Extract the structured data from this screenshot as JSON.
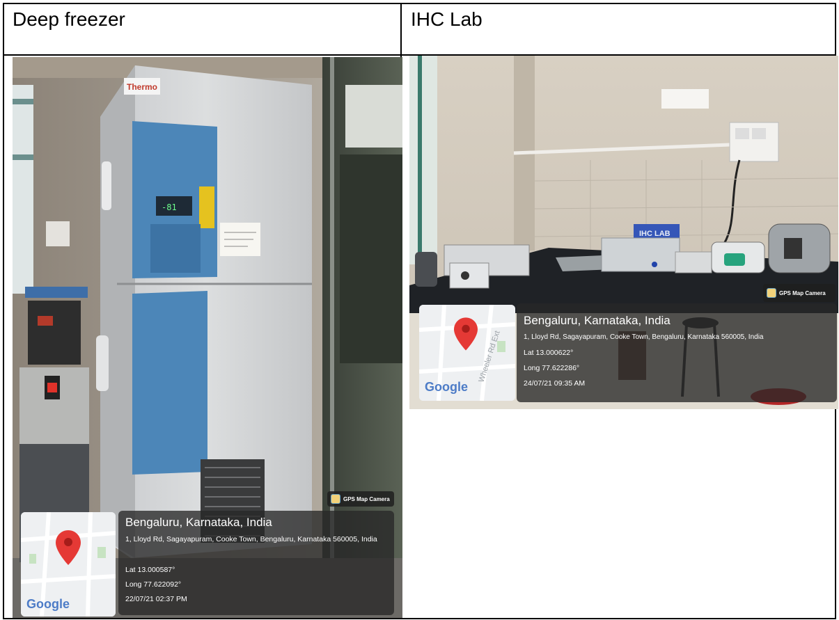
{
  "table": {
    "left_header": "Deep freezer",
    "right_header": "IHC Lab"
  },
  "left_photo": {
    "freezer_brand": "Thermo",
    "display_reading": "-81",
    "badge": "GPS Map Camera",
    "map_logo": "Google",
    "city": "Bengaluru, Karnataka, India",
    "address": "1, Lloyd Rd, Sagayapuram, Cooke Town, Bengaluru, Karnataka 560005, India",
    "lat": "Lat 13.000587°",
    "long": "Long 77.622092°",
    "timestamp": "22/07/21 02:37 PM"
  },
  "right_photo": {
    "lab_sign": "IHC LAB",
    "badge": "GPS Map Camera",
    "map_logo": "Google",
    "map_road": "Wheeler Rd Ext",
    "city": "Bengaluru, Karnataka, India",
    "address": "1, Lloyd Rd, Sagayapuram, Cooke Town, Bengaluru, Karnataka 560005, India",
    "lat": "Lat 13.000622°",
    "long": "Long 77.622286°",
    "timestamp": "24/07/21 09:35 AM"
  },
  "icons": {
    "map_pin": "map-pin-icon",
    "badge_icon": "camera-app-icon"
  },
  "colors": {
    "pin_red": "#e53935",
    "freezer_blue": "#4c86b8",
    "overlay": "#282828"
  }
}
